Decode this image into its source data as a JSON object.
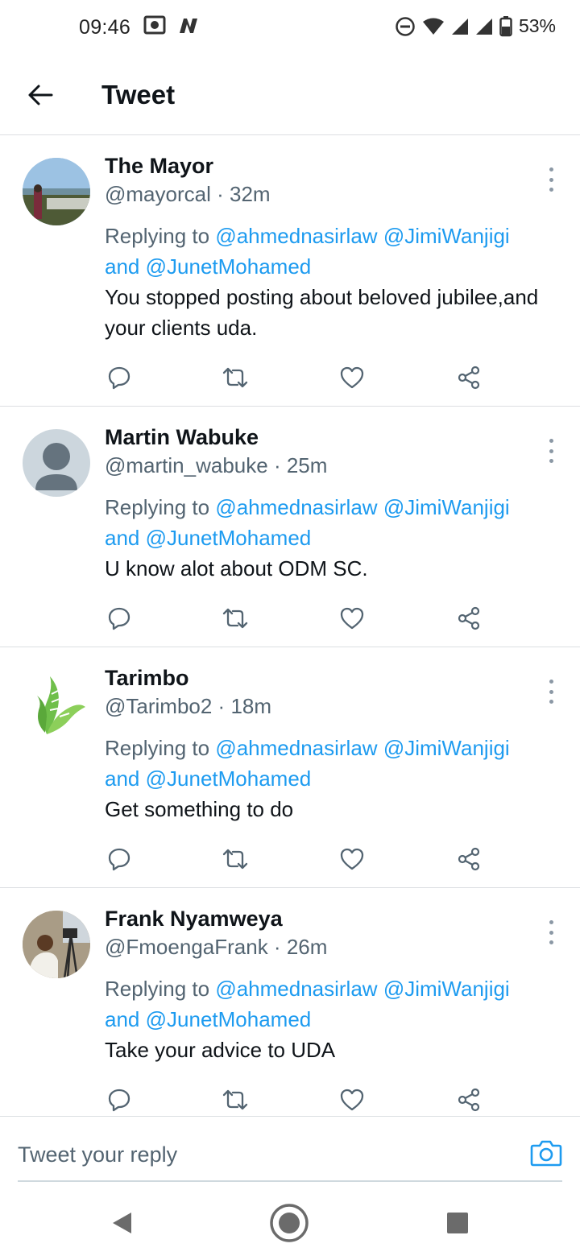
{
  "status_bar": {
    "time": "09:46",
    "battery_text": "53%",
    "icons": [
      "camera-frame-icon",
      "n-app-icon",
      "do-not-disturb-icon",
      "wifi-icon",
      "signal-icon",
      "signal-icon",
      "battery-icon"
    ]
  },
  "header": {
    "title": "Tweet",
    "back_icon": "arrow-left-icon"
  },
  "tweets": [
    {
      "name": "The Mayor",
      "handle": "@mayorcal",
      "time": "32m",
      "replying_label": "Replying to",
      "mention_1": "@ahmednasirlaw",
      "mention_2": "@JimiWanjigi",
      "and_label": "and",
      "mention_3": "@JunetMohamed",
      "text": "You stopped posting about beloved jubilee,and your clients uda.",
      "avatar": "photo"
    },
    {
      "name": "Martin Wabuke",
      "handle": "@martin_wabuke",
      "time": "25m",
      "replying_label": "Replying to",
      "mention_1": "@ahmednasirlaw",
      "mention_2": "@JimiWanjigi",
      "and_label": "and",
      "mention_3": "@JunetMohamed",
      "text": "U know alot about ODM SC.",
      "avatar": "default"
    },
    {
      "name": "Tarimbo",
      "handle": "@Tarimbo2",
      "time": "18m",
      "replying_label": "Replying to",
      "mention_1": "@ahmednasirlaw",
      "mention_2": "@JimiWanjigi",
      "and_label": "and",
      "mention_3": "@JunetMohamed",
      "text": "Get something to do",
      "avatar": "logo"
    },
    {
      "name": "Frank Nyamweya",
      "handle": "@FmoengaFrank",
      "time": "26m",
      "replying_label": "Replying to",
      "mention_1": "@ahmednasirlaw",
      "mention_2": "@JimiWanjigi",
      "and_label": "and",
      "mention_3": "@JunetMohamed",
      "text": "Take your advice to UDA",
      "avatar": "photo"
    }
  ],
  "reply_bar": {
    "placeholder": "Tweet your reply",
    "camera_icon": "camera-icon"
  },
  "nav_bar": {
    "icons": [
      "back-triangle-icon",
      "home-circle-icon",
      "recents-square-icon"
    ]
  },
  "colors": {
    "accent": "#1d9bf0",
    "text_primary": "#0f1419",
    "text_secondary": "#536471",
    "divider": "#dcdfe2"
  }
}
